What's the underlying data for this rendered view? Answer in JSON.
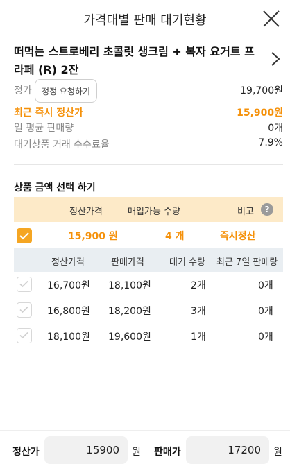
{
  "header": {
    "title": "가격대별 판매 대기현황"
  },
  "product": {
    "title": "떠먹는 스트로베리 초콜릿 생크림 + 복자 요거트 프라페 (R) 2잔"
  },
  "info": {
    "list_price_label": "정가",
    "correct_button": "정정 요청하기",
    "list_price_value": "19,700원",
    "recent_settle_label": "최근 즉시 정산가",
    "recent_settle_value": "15,900원",
    "daily_avg_label": "일 평균 판매량",
    "daily_avg_value": "0개",
    "fee_label": "대기상품 거래 수수료율",
    "fee_value": "7.9%"
  },
  "select_section": {
    "title": "상품 금액 선택 하기",
    "head": {
      "settle_price": "정산가격",
      "buy_qty": "매입가능 수량",
      "note": "비고",
      "help": "?"
    },
    "instant": {
      "price": "15,900 원",
      "qty": "4 개",
      "note": "즉시정산"
    }
  },
  "wait_table": {
    "headers": [
      "정산가격",
      "판매가격",
      "대기 수량",
      "최근 7일 판매량"
    ],
    "rows": [
      [
        "16,700원",
        "18,100원",
        "2개",
        "0개"
      ],
      [
        "16,800원",
        "18,200원",
        "3개",
        "0개"
      ],
      [
        "18,100원",
        "19,600원",
        "1개",
        "0개"
      ]
    ]
  },
  "bottom": {
    "settle_label": "정산가",
    "settle_value": "15900",
    "settle_unit": "원",
    "sale_label": "판매가",
    "sale_value": "17200",
    "sale_unit": "원"
  },
  "colors": {
    "accent": "#f5910a",
    "checkbox_checked": "#f5a623",
    "orange_header_bg": "#fdeac8",
    "gray_header_bg": "#e9eef2"
  }
}
